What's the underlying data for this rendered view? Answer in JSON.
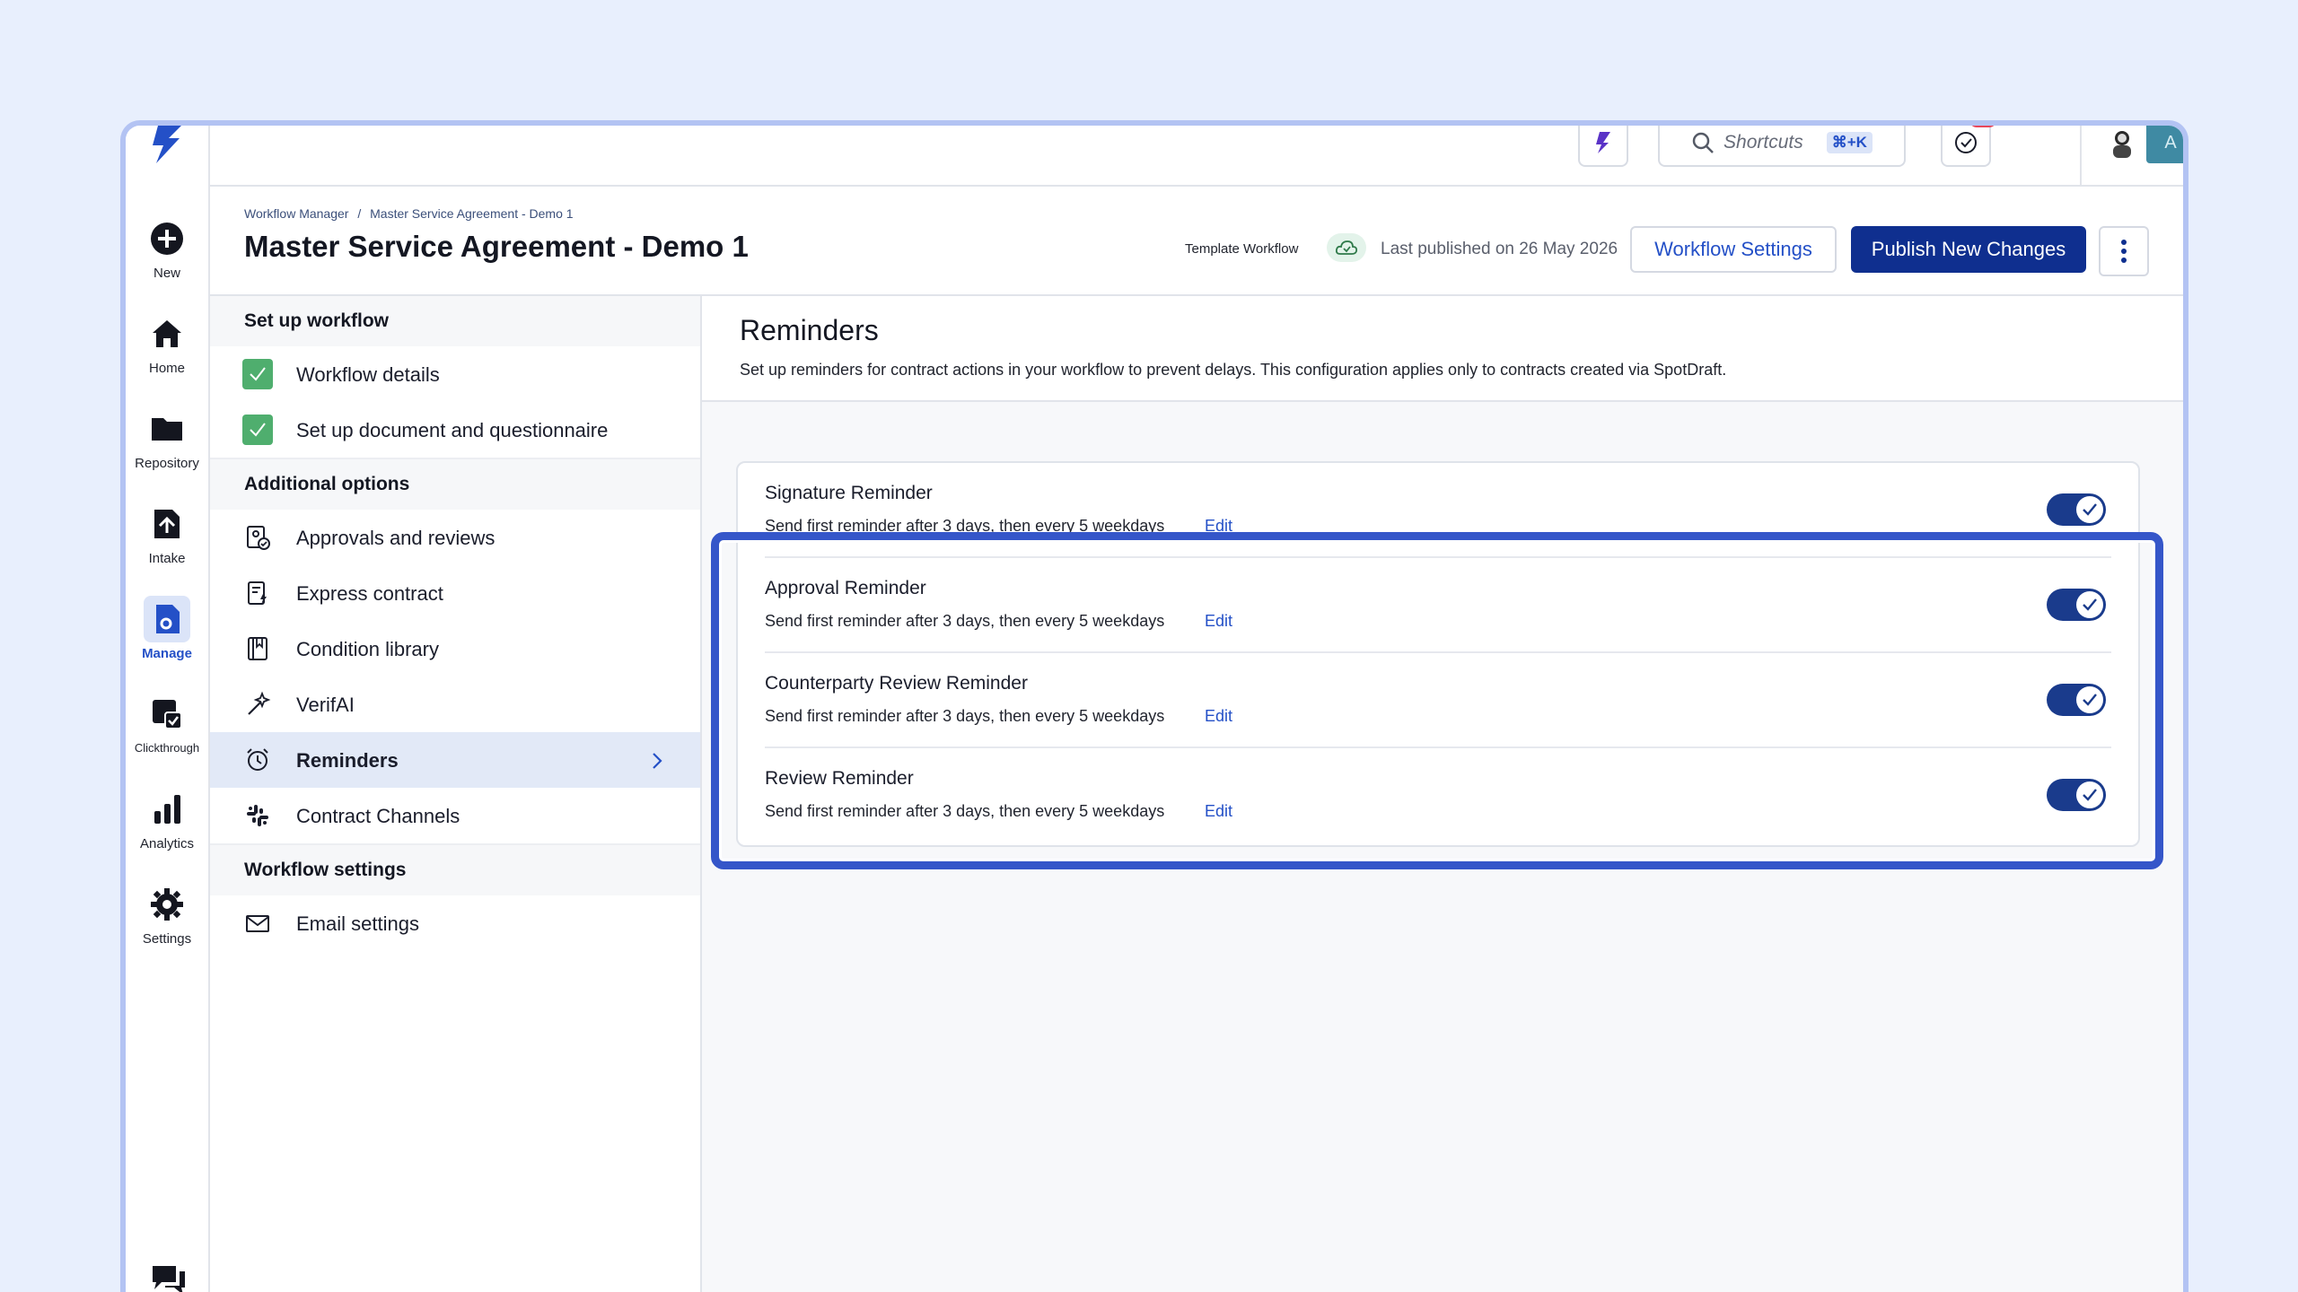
{
  "rail": {
    "items": [
      {
        "label": "New",
        "icon": "plus-circle-icon"
      },
      {
        "label": "Home",
        "icon": "home-icon"
      },
      {
        "label": "Repository",
        "icon": "folder-icon"
      },
      {
        "label": "Intake",
        "icon": "intake-icon"
      },
      {
        "label": "Manage",
        "icon": "manage-icon"
      },
      {
        "label": "Clickthrough",
        "icon": "clickthrough-icon"
      },
      {
        "label": "Analytics",
        "icon": "analytics-icon"
      },
      {
        "label": "Settings",
        "icon": "gear-icon"
      }
    ],
    "active": "Manage"
  },
  "topbar": {
    "search_placeholder": "Shortcuts",
    "shortcut": "⌘+K",
    "avatar_initial": "A"
  },
  "header": {
    "breadcrumb": [
      "Workflow Manager",
      "/",
      "Master Service Agreement - Demo 1"
    ],
    "title": "Master Service Agreement - Demo 1",
    "template_label": "Template Workflow",
    "published": "Last published on 26 May 2026",
    "settings_button": "Workflow Settings",
    "publish_button": "Publish New Changes"
  },
  "nav": {
    "setup_heading": "Set up workflow",
    "setup_items": [
      "Workflow details",
      "Set up document and questionnaire"
    ],
    "additional_heading": "Additional options",
    "additional_items": [
      "Approvals and reviews",
      "Express contract",
      "Condition library",
      "VerifAI",
      "Reminders",
      "Contract Channels"
    ],
    "settings_heading": "Workflow settings",
    "settings_items": [
      "Email settings"
    ],
    "active": "Reminders"
  },
  "main": {
    "title": "Reminders",
    "description": "Set up reminders for contract actions in your workflow to prevent delays. This configuration applies only to contracts created via SpotDraft.",
    "reminders": [
      {
        "title": "Signature Reminder",
        "desc": "Send first reminder after 3 days, then every 5 weekdays",
        "edit": "Edit",
        "enabled": true
      },
      {
        "title": "Approval Reminder",
        "desc": "Send first reminder after 3 days, then every 5 weekdays",
        "edit": "Edit",
        "enabled": true
      },
      {
        "title": "Counterparty Review Reminder",
        "desc": "Send first reminder after 3 days, then every 5 weekdays",
        "edit": "Edit",
        "enabled": true
      },
      {
        "title": "Review Reminder",
        "desc": "Send first reminder after 3 days, then every 5 weekdays",
        "edit": "Edit",
        "enabled": true
      }
    ]
  },
  "colors": {
    "accent": "#2450c7",
    "primary_button": "#0f2f8f",
    "toggle_on": "#1a3b8c",
    "highlight": "#3556c9",
    "check": "#4fae6e"
  }
}
